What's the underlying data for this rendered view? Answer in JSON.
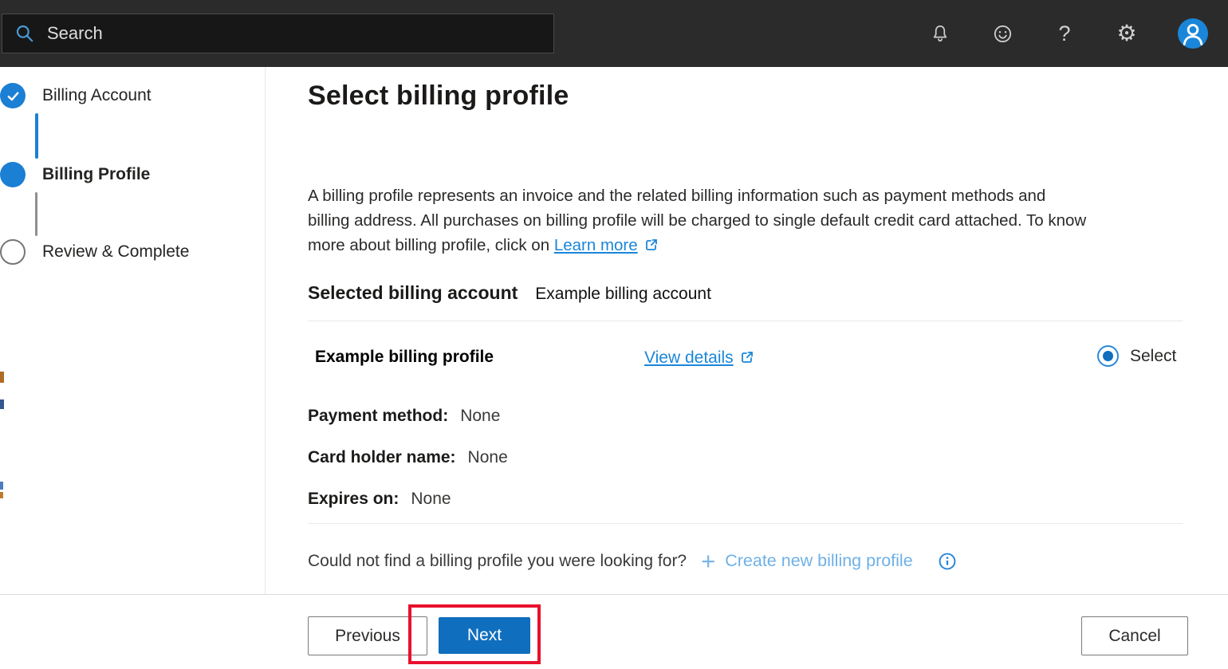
{
  "topbar": {
    "search_placeholder": "Search",
    "help_glyph": "?",
    "gear_glyph": "⚙"
  },
  "wizard": {
    "steps": [
      {
        "label": "Billing Account",
        "state": "completed"
      },
      {
        "label": "Billing Profile",
        "state": "current"
      },
      {
        "label": "Review & Complete",
        "state": "upcoming"
      }
    ]
  },
  "main": {
    "title": "Select billing profile",
    "description_lines": [
      "A billing profile represents an invoice and the related billing information such as payment methods and",
      "billing address. All purchases on billing profile will be charged to single default credit card attached. To know",
      "more about billing profile, click on"
    ],
    "learn_more_label": "Learn more",
    "selected_account_heading": "Selected billing account",
    "selected_account_value": "Example billing account",
    "profile": {
      "name": "Example billing profile",
      "view_details_label": "View details",
      "select_label": "Select",
      "selected": true,
      "details": [
        {
          "label": "Payment method:",
          "value": "None"
        },
        {
          "label": "Card holder name:",
          "value": "None"
        },
        {
          "label": "Expires on:",
          "value": "None"
        }
      ]
    },
    "not_found_text": "Could not find a billing profile you were looking for?",
    "create_new_plus_glyph": "+",
    "create_new_label": "Create new billing profile"
  },
  "footer": {
    "previous_label": "Previous",
    "next_label": "Next",
    "cancel_label": "Cancel"
  },
  "colors": {
    "topbar_bg": "#2b2b2b",
    "accent_blue": "#106ebe",
    "step_blue": "#1b7fd4",
    "link_blue": "#1a86d9",
    "create_link_blue": "#6fb1e6",
    "annotation_red": "#e8112d"
  }
}
